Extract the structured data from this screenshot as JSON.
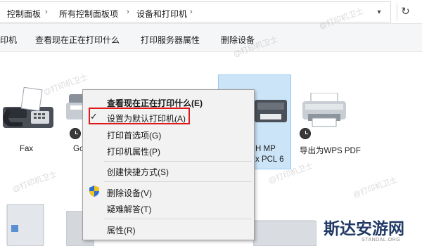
{
  "breadcrumb": {
    "items": [
      "控制面板",
      "所有控制面板项",
      "设备和打印机"
    ],
    "separator": "›"
  },
  "address_icons": {
    "dropdown": "chevron-down-icon",
    "refresh": "refresh-icon"
  },
  "toolbar": {
    "items": [
      "印机",
      "查看现在正在打印什么",
      "打印服务器属性",
      "删除设备"
    ]
  },
  "devices": [
    {
      "label": "Fax",
      "icon": "fax-icon"
    },
    {
      "label": "Go",
      "icon": "printer-icon",
      "status": "clock-badge"
    },
    {
      "label": "H MP",
      "label2": "x PCL 6",
      "icon": "printer-icon",
      "selected": true
    },
    {
      "label": "导出为WPS PDF",
      "icon": "printer-icon",
      "status": "clock-badge"
    }
  ],
  "context_menu": {
    "items": [
      {
        "label": "查看现在正在打印什么(E)",
        "bold": true
      },
      {
        "label": "设置为默认打印机(A)",
        "checked": true,
        "highlighted": true
      },
      {
        "label": "打印首选项(G)"
      },
      {
        "label": "打印机属性(P)"
      },
      {
        "label": "创建快捷方式(S)"
      },
      {
        "label": "删除设备(V)",
        "icon": "uac-shield-icon"
      },
      {
        "label": "疑难解答(T)"
      },
      {
        "label": "属性(R)"
      }
    ],
    "highlight_color": "#e0191a"
  },
  "watermark": "@打印机卫士",
  "logo": {
    "main": "斯达安游网",
    "sub": "STANDAL.ORG"
  },
  "colors": {
    "selection": "#cce4f7",
    "selection_border": "#99c9ef",
    "accent": "#e0191a"
  }
}
